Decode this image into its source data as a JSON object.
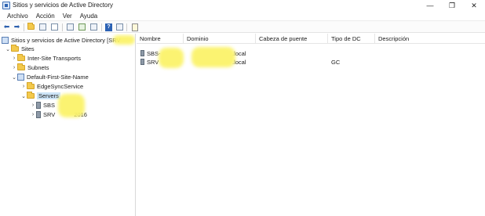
{
  "window": {
    "title": "Sitios y servicios de Active Directory",
    "controls": {
      "minimize": "—",
      "maximize": "❐",
      "close": "✕"
    }
  },
  "menu": [
    "Archivo",
    "Acción",
    "Ver",
    "Ayuda"
  ],
  "toolbar": {
    "back_icon": "arrow-left-icon",
    "forward_icon": "arrow-right-icon",
    "help_label": "?"
  },
  "tree": {
    "root": "Sitios y servicios de Active Directory [SRV",
    "sites": "Sites",
    "inter_site": "Inter-Site Transports",
    "subnets": "Subnets",
    "default_site": "Default-First-Site-Name",
    "edgesync": "EdgeSyncService",
    "servers": "Servers",
    "server1": "SBS",
    "server2_prefix": "SRV",
    "server2_suffix": "2016"
  },
  "list": {
    "columns": [
      "Nombre",
      "Dominio",
      "Cabeza de puente",
      "Tipo de DC",
      "Descripción"
    ],
    "rows": [
      {
        "name": "SBS-",
        "domain": ".local",
        "bridgehead": "",
        "dc_type": "",
        "description": ""
      },
      {
        "name": "SRV",
        "domain": ".local",
        "bridgehead": "",
        "dc_type": "GC",
        "description": ""
      }
    ]
  },
  "colors": {
    "selection": "#cce4f7",
    "folder": "#f3c94c",
    "redaction": "#fbf36a"
  }
}
